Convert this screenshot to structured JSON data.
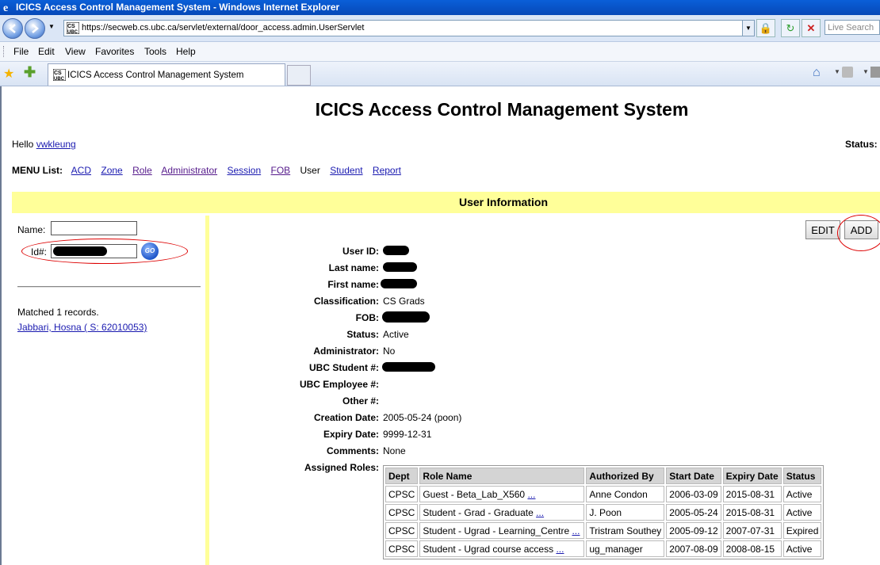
{
  "window": {
    "title": "ICICS Access Control Management System - Windows Internet Explorer"
  },
  "browser": {
    "url": "https://secweb.cs.ubc.ca/servlet/external/door_access.admin.UserServlet",
    "search_placeholder": "Live Search",
    "menu": [
      "File",
      "Edit",
      "View",
      "Favorites",
      "Tools",
      "Help"
    ],
    "tab_title": "ICICS Access Control Management System"
  },
  "page": {
    "title": "ICICS Access Control Management System",
    "hello_prefix": "Hello",
    "username": "vwkleung",
    "status_label": "Status: I",
    "menu_label": "MENU List:",
    "menu_items": [
      "ACD",
      "Zone",
      "Role",
      "Administrator",
      "Session",
      "FOB",
      "User",
      "Student",
      "Report"
    ],
    "section_title": "User Information"
  },
  "search": {
    "name_label": "Name:",
    "id_label": "Id#:",
    "go_label": "GO",
    "matched_text": "Matched 1 records.",
    "result_link": "Jabbari, Hosna ( S: 62010053)"
  },
  "actions": {
    "edit": "EDIT",
    "add": "ADD"
  },
  "user": {
    "fields": [
      {
        "label": "User ID:",
        "value": ""
      },
      {
        "label": "Last name:",
        "value": ""
      },
      {
        "label": "First name:",
        "value": ""
      },
      {
        "label": "Classification:",
        "value": "CS Grads"
      },
      {
        "label": "FOB:",
        "value": ""
      },
      {
        "label": "Status:",
        "value": "Active"
      },
      {
        "label": "Administrator:",
        "value": "No"
      },
      {
        "label": "UBC Student #:",
        "value": ""
      },
      {
        "label": "UBC Employee #:",
        "value": ""
      },
      {
        "label": "Other #:",
        "value": ""
      },
      {
        "label": "Creation Date:",
        "value": "2005-05-24 (poon)"
      },
      {
        "label": "Expiry Date:",
        "value": "9999-12-31"
      },
      {
        "label": "Comments:",
        "value": "None"
      },
      {
        "label": "Assigned Roles:",
        "value": ""
      }
    ]
  },
  "roles": {
    "headers": [
      "Dept",
      "Role Name",
      "Authorized By",
      "Start Date",
      "Expiry Date",
      "Status"
    ],
    "rows": [
      {
        "dept": "CPSC",
        "role": "Guest - Beta_Lab_X560",
        "more": "...",
        "by": "Anne Condon",
        "start": "2006-03-09",
        "expiry": "2015-08-31",
        "status": "Active"
      },
      {
        "dept": "CPSC",
        "role": "Student - Grad - Graduate",
        "more": "...",
        "by": "J. Poon",
        "start": "2005-05-24",
        "expiry": "2015-08-31",
        "status": "Active"
      },
      {
        "dept": "CPSC",
        "role": "Student - Ugrad - Learning_Centre",
        "more": "...",
        "by": "Tristram Southey",
        "start": "2005-09-12",
        "expiry": "2007-07-31",
        "status": "Expired"
      },
      {
        "dept": "CPSC",
        "role": "Student - Ugrad course access",
        "more": "...",
        "by": "ug_manager",
        "start": "2007-08-09",
        "expiry": "2008-08-15",
        "status": "Active"
      }
    ]
  }
}
